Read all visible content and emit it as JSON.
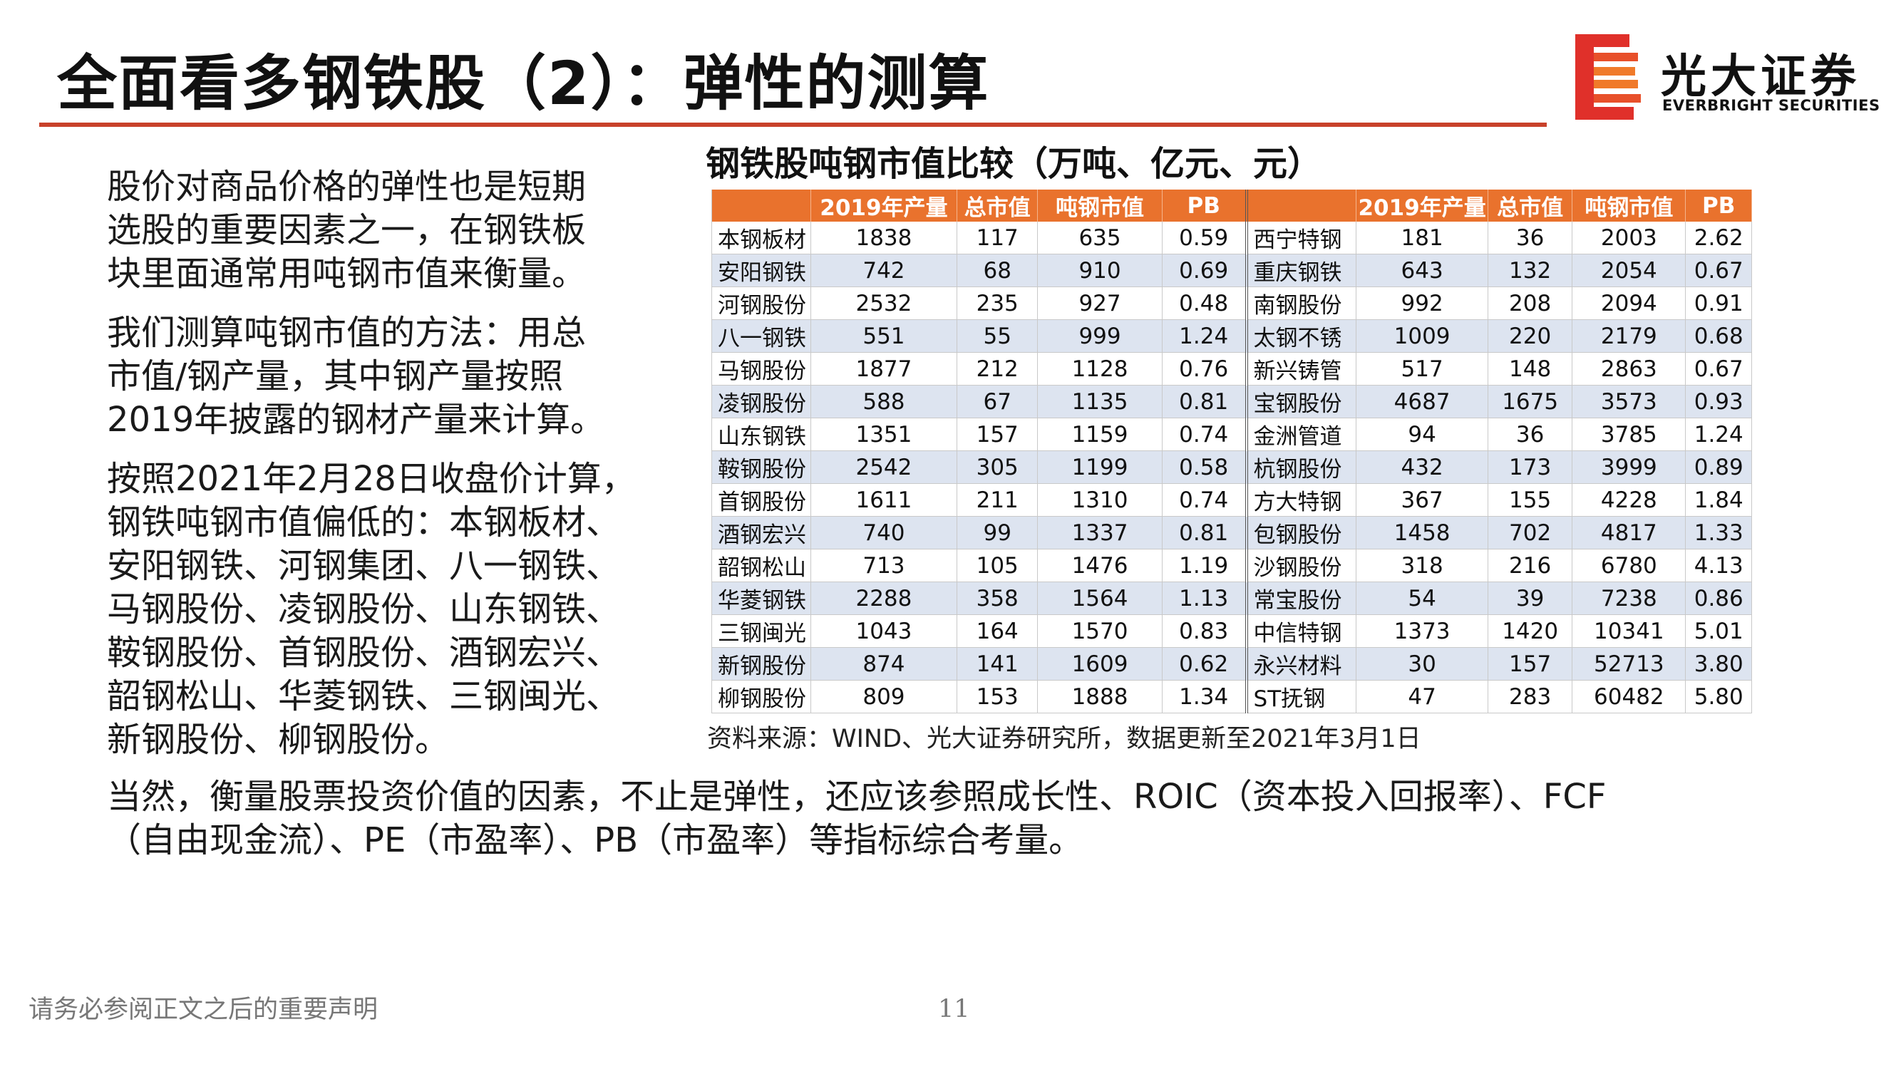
{
  "header": {
    "title": "全面看多钢铁股（2）：弹性的测算",
    "logo_cn": "光大证券",
    "logo_en": "EVERBRIGHT SECURITIES",
    "accent_color": "#c8412a",
    "logo_color": "#e0302a"
  },
  "left_text": {
    "para1": [
      "股价对商品价格的弹性也是短期",
      "选股的重要因素之一，在钢铁板",
      "块里面通常用吨钢市值来衡量。"
    ],
    "para2": [
      "我们测算吨钢市值的方法：用总",
      "市值/钢产量，其中钢产量按照",
      "2019年披露的钢材产量来计算。"
    ],
    "para3": [
      "按照2021年2月28日收盘价计算，",
      "钢铁吨钢市值偏低的：本钢板材、",
      "安阳钢铁、河钢集团、八一钢铁、",
      "马钢股份、凌钢股份、山东钢铁、",
      "鞍钢股份、首钢股份、酒钢宏兴、",
      "韶钢松山、华菱钢铁、三钢闽光、",
      "新钢股份、柳钢股份。"
    ]
  },
  "table": {
    "title": "钢铁股吨钢市值比较（万吨、亿元、元）",
    "header_color": "#e9722d",
    "alt_row_color": "#dde4f0",
    "headers": [
      "",
      "2019年产量",
      "总市值",
      "吨钢市值",
      "PB",
      "",
      "2019年产量",
      "总市值",
      "吨钢市值",
      "PB"
    ],
    "rows": [
      [
        "本钢板材",
        "1838",
        "117",
        "635",
        "0.59",
        "西宁特钢",
        "181",
        "36",
        "2003",
        "2.62"
      ],
      [
        "安阳钢铁",
        "742",
        "68",
        "910",
        "0.69",
        "重庆钢铁",
        "643",
        "132",
        "2054",
        "0.67"
      ],
      [
        "河钢股份",
        "2532",
        "235",
        "927",
        "0.48",
        "南钢股份",
        "992",
        "208",
        "2094",
        "0.91"
      ],
      [
        "八一钢铁",
        "551",
        "55",
        "999",
        "1.24",
        "太钢不锈",
        "1009",
        "220",
        "2179",
        "0.68"
      ],
      [
        "马钢股份",
        "1877",
        "212",
        "1128",
        "0.76",
        "新兴铸管",
        "517",
        "148",
        "2863",
        "0.67"
      ],
      [
        "凌钢股份",
        "588",
        "67",
        "1135",
        "0.81",
        "宝钢股份",
        "4687",
        "1675",
        "3573",
        "0.93"
      ],
      [
        "山东钢铁",
        "1351",
        "157",
        "1159",
        "0.74",
        "金洲管道",
        "94",
        "36",
        "3785",
        "1.24"
      ],
      [
        "鞍钢股份",
        "2542",
        "305",
        "1199",
        "0.58",
        "杭钢股份",
        "432",
        "173",
        "3999",
        "0.89"
      ],
      [
        "首钢股份",
        "1611",
        "211",
        "1310",
        "0.74",
        "方大特钢",
        "367",
        "155",
        "4228",
        "1.84"
      ],
      [
        "酒钢宏兴",
        "740",
        "99",
        "1337",
        "0.81",
        "包钢股份",
        "1458",
        "702",
        "4817",
        "1.33"
      ],
      [
        "韶钢松山",
        "713",
        "105",
        "1476",
        "1.19",
        "沙钢股份",
        "318",
        "216",
        "6780",
        "4.13"
      ],
      [
        "华菱钢铁",
        "2288",
        "358",
        "1564",
        "1.13",
        "常宝股份",
        "54",
        "39",
        "7238",
        "0.86"
      ],
      [
        "三钢闽光",
        "1043",
        "164",
        "1570",
        "0.83",
        "中信特钢",
        "1373",
        "1420",
        "10341",
        "5.01"
      ],
      [
        "新钢股份",
        "874",
        "141",
        "1609",
        "0.62",
        "永兴材料",
        "30",
        "157",
        "52713",
        "3.80"
      ],
      [
        "柳钢股份",
        "809",
        "153",
        "1888",
        "1.34",
        "ST抚钢",
        "47",
        "283",
        "60482",
        "5.80"
      ]
    ],
    "source": "资料来源：WIND、光大证券研究所，数据更新至2021年3月1日"
  },
  "bottom_text": {
    "line1": "当然，衡量股票投资价值的因素，不止是弹性，还应该参照成长性、ROIC（资本投入回报率）、FCF",
    "line2": "（自由现金流）、PE（市盈率）、PB（市盈率）等指标综合考量。"
  },
  "footer": {
    "disclaimer": "请务必参阅正文之后的重要声明",
    "page_number": "11"
  }
}
